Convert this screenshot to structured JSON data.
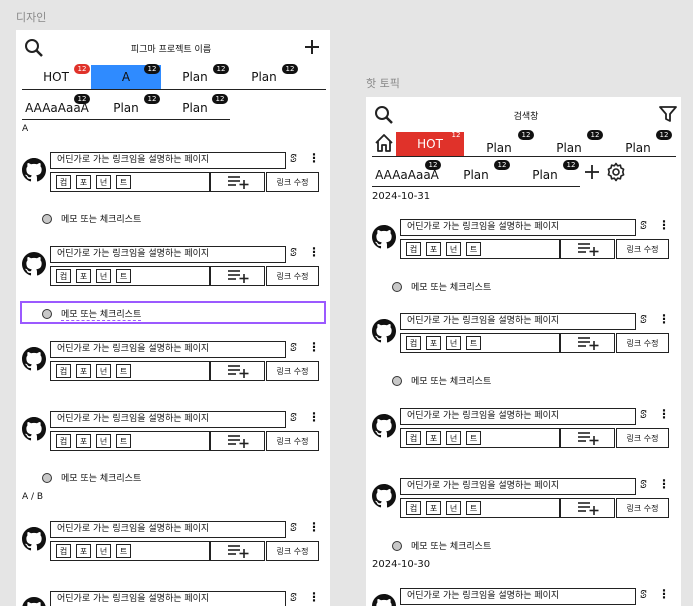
{
  "left_panel": {
    "frame_label": "디자인",
    "title": "피그마 프로젝트 이름",
    "tabs_row1": [
      {
        "label": "HOT",
        "badge": "12"
      },
      {
        "label": "A",
        "badge": "12"
      },
      {
        "label": "Plan",
        "badge": "12"
      },
      {
        "label": "Plan",
        "badge": "12"
      }
    ],
    "tabs_row2": [
      {
        "label": "AAAaAaaA",
        "badge": "12"
      },
      {
        "label": "Plan",
        "badge": "12"
      },
      {
        "label": "Plan",
        "badge": "12"
      }
    ],
    "section_a": "A",
    "section_ab": "A / B"
  },
  "right_panel": {
    "frame_label": "핫 토픽",
    "search_title": "검색창",
    "tabs_row1": [
      {
        "label": "HOT",
        "badge": "12"
      },
      {
        "label": "Plan",
        "badge": "12"
      },
      {
        "label": "Plan",
        "badge": "12"
      },
      {
        "label": "Plan",
        "badge": "12"
      }
    ],
    "tabs_row2": [
      {
        "label": "AAAaAaaA",
        "badge": "12"
      },
      {
        "label": "Plan",
        "badge": "12"
      },
      {
        "label": "Plan",
        "badge": "12"
      }
    ],
    "date1": "2024-10-31",
    "date2": "2024-10-30"
  },
  "card": {
    "link_title": "어딘가로 가는 링크임을 설명하는 페이지",
    "tags": [
      "컴",
      "포",
      "넌",
      "트"
    ],
    "edit_label": "링크 수정"
  },
  "memo_text": "메모 또는 체크리스트",
  "colors": {
    "active_blue": "#2f8bff",
    "hot_red": "#e0322a",
    "selection": "#9b59ff"
  }
}
